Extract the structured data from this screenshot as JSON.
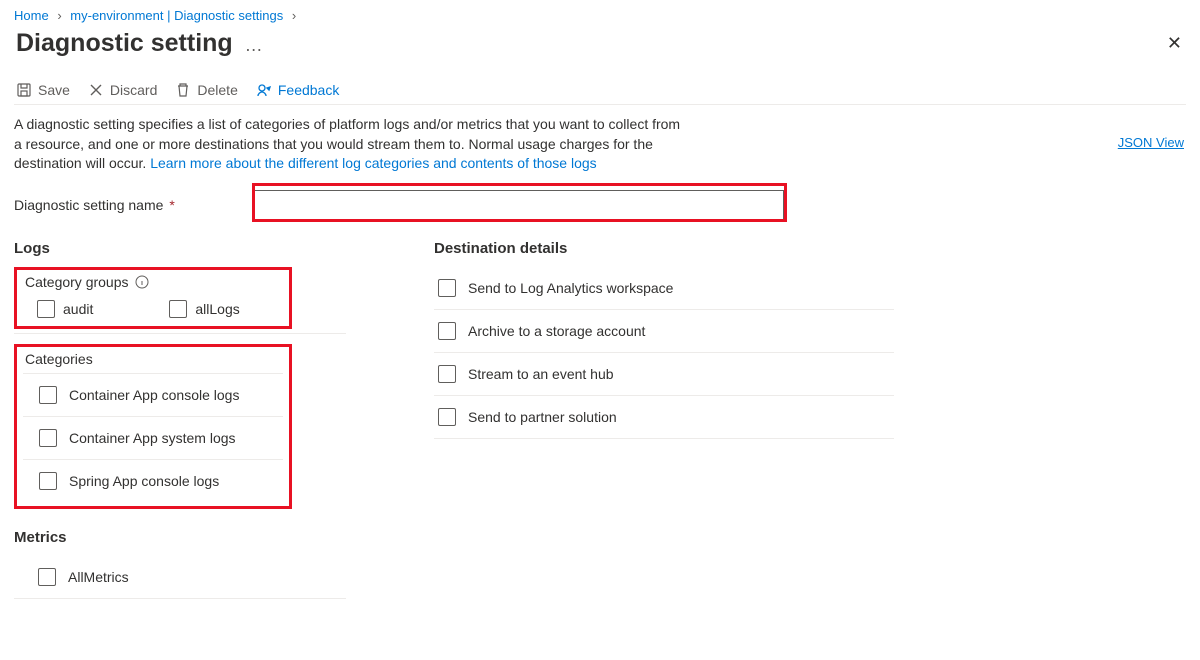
{
  "breadcrumb": {
    "home": "Home",
    "env": "my-environment | Diagnostic settings"
  },
  "page_title": "Diagnostic setting",
  "toolbar": {
    "save": "Save",
    "discard": "Discard",
    "delete": "Delete",
    "feedback": "Feedback"
  },
  "description": {
    "text": "A diagnostic setting specifies a list of categories of platform logs and/or metrics that you want to collect from a resource, and one or more destinations that you would stream them to. Normal usage charges for the destination will occur. ",
    "link": "Learn more about the different log categories and contents of those logs"
  },
  "json_view": "JSON View",
  "name_field": {
    "label": "Diagnostic setting name",
    "value": "",
    "required": "*"
  },
  "logs": {
    "heading": "Logs",
    "category_groups_label": "Category groups",
    "groups": {
      "audit": "audit",
      "all": "allLogs"
    },
    "categories_label": "Categories",
    "categories": [
      "Container App console logs",
      "Container App system logs",
      "Spring App console logs"
    ]
  },
  "metrics": {
    "heading": "Metrics",
    "all": "AllMetrics"
  },
  "destinations": {
    "heading": "Destination details",
    "items": [
      "Send to Log Analytics workspace",
      "Archive to a storage account",
      "Stream to an event hub",
      "Send to partner solution"
    ]
  }
}
